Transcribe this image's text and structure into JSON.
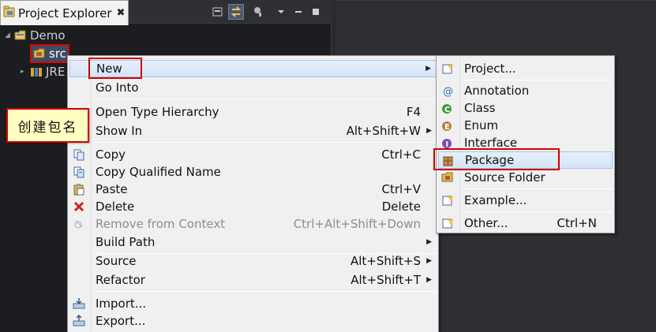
{
  "explorer": {
    "tab_title": "Project Explorer",
    "tab_close": "✖",
    "tree": [
      {
        "label": "Demo",
        "icon": "project-folder-icon"
      },
      {
        "label": "src",
        "icon": "source-package-folder-icon"
      },
      {
        "label": "JRE",
        "icon": "library-icon"
      }
    ]
  },
  "context_menu": {
    "items": [
      {
        "label": "New",
        "accel": "",
        "submenu": true,
        "icon": "",
        "highlighted": true
      },
      {
        "label": "Go Into",
        "accel": "",
        "submenu": false,
        "icon": ""
      },
      {
        "label": "Open Type Hierarchy",
        "accel": "F4",
        "submenu": false,
        "icon": ""
      },
      {
        "label": "Show In",
        "accel": "Alt+Shift+W",
        "submenu": true,
        "icon": ""
      },
      {
        "label": "Copy",
        "accel": "Ctrl+C",
        "submenu": false,
        "icon": "copy-icon"
      },
      {
        "label": "Copy Qualified Name",
        "accel": "",
        "submenu": false,
        "icon": "copy-qualified-name-icon"
      },
      {
        "label": "Paste",
        "accel": "Ctrl+V",
        "submenu": false,
        "icon": "paste-icon"
      },
      {
        "label": "Delete",
        "accel": "Delete",
        "submenu": false,
        "icon": "delete-icon"
      },
      {
        "label": "Remove from Context",
        "accel": "Ctrl+Alt+Shift+Down",
        "submenu": false,
        "icon": "remove-from-context-icon",
        "disabled": true
      },
      {
        "label": "Build Path",
        "accel": "",
        "submenu": true,
        "icon": ""
      },
      {
        "label": "Source",
        "accel": "Alt+Shift+S",
        "submenu": true,
        "icon": ""
      },
      {
        "label": "Refactor",
        "accel": "Alt+Shift+T",
        "submenu": true,
        "icon": ""
      },
      {
        "label": "Import...",
        "accel": "",
        "submenu": false,
        "icon": "import-icon"
      },
      {
        "label": "Export...",
        "accel": "",
        "submenu": false,
        "icon": "export-icon"
      }
    ]
  },
  "new_submenu": {
    "items": [
      {
        "label": "Project...",
        "accel": "",
        "icon": "new-project-icon"
      },
      {
        "label": "Annotation",
        "accel": "",
        "icon": "annotation-icon"
      },
      {
        "label": "Class",
        "accel": "",
        "icon": "class-icon"
      },
      {
        "label": "Enum",
        "accel": "",
        "icon": "enum-icon"
      },
      {
        "label": "Interface",
        "accel": "",
        "icon": "interface-icon"
      },
      {
        "label": "Package",
        "accel": "",
        "icon": "package-icon",
        "highlighted": true
      },
      {
        "label": "Source Folder",
        "accel": "",
        "icon": "source-folder-icon"
      },
      {
        "label": "Example...",
        "accel": "",
        "icon": "example-icon"
      },
      {
        "label": "Other...",
        "accel": "Ctrl+N",
        "icon": "other-icon"
      }
    ]
  },
  "annotation": {
    "text": "创建包名"
  },
  "colors": {
    "highlight_border": "#d40000",
    "callout_bg": "#ffffc2",
    "menu_bg": "#f0f0f0",
    "hover_bg": "#d4e4f6"
  }
}
